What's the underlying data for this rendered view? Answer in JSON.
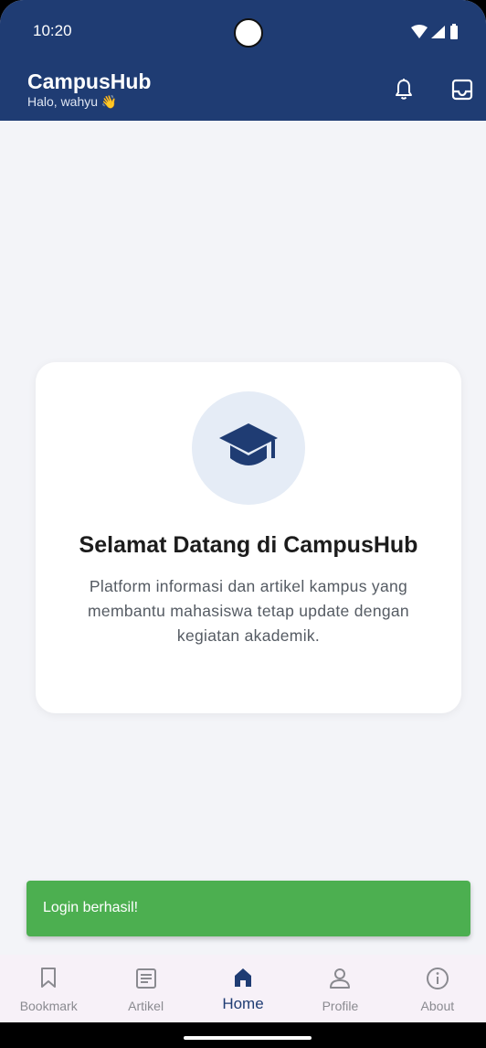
{
  "status_bar": {
    "time": "10:20"
  },
  "app_bar": {
    "title": "CampusHub",
    "subtitle": "Halo, wahyu 👋",
    "actions": [
      "bell-icon",
      "inbox-icon"
    ]
  },
  "welcome": {
    "icon": "graduation-cap-icon",
    "title": "Selamat Datang di CampusHub",
    "description": "Platform informasi dan artikel kampus yang membantu mahasiswa tetap update dengan kegiatan akademik."
  },
  "toast": {
    "message": "Login berhasil!"
  },
  "bottom_nav": {
    "items": [
      {
        "label": "Bookmark",
        "icon": "bookmark-icon",
        "active": false
      },
      {
        "label": "Artikel",
        "icon": "article-icon",
        "active": false
      },
      {
        "label": "Home",
        "icon": "home-icon",
        "active": true
      },
      {
        "label": "Profile",
        "icon": "profile-icon",
        "active": false
      },
      {
        "label": "About",
        "icon": "info-icon",
        "active": false
      }
    ]
  },
  "colors": {
    "primary": "#1f3c73",
    "background": "#f3f4f8",
    "toast": "#4caf50",
    "icon_circle": "#e5ecf6",
    "nav_background": "#f7f1f8",
    "nav_inactive": "#8a8a90"
  }
}
